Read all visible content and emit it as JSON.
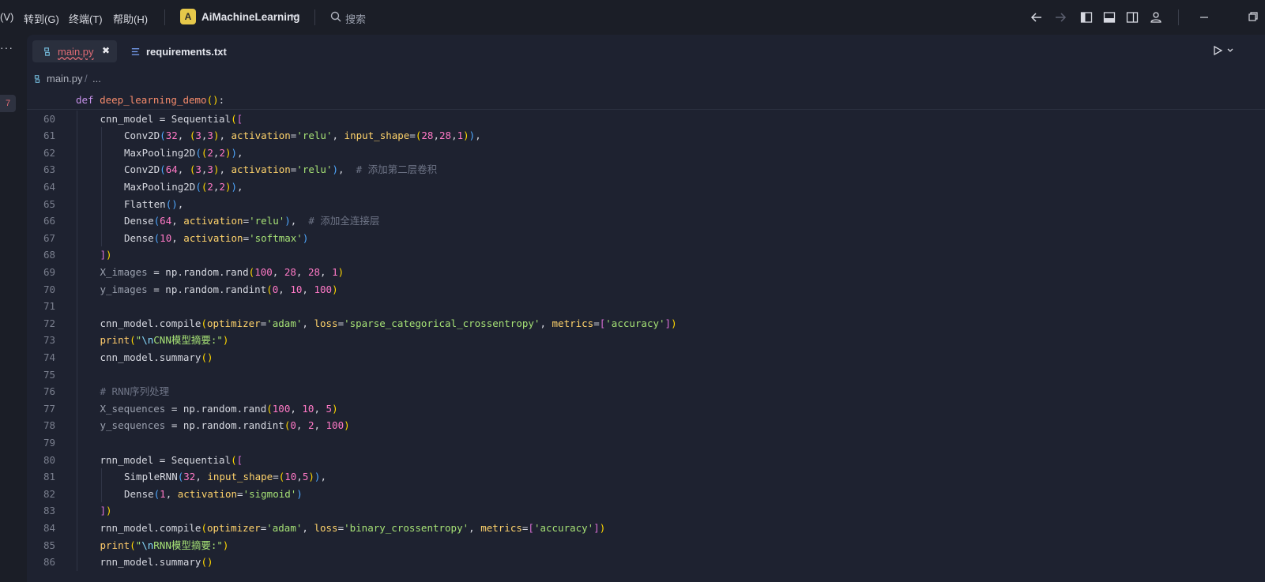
{
  "menubar": {
    "view_fragment": "(V)",
    "goto": "转到(G)",
    "terminal": "终端(T)",
    "help": "帮助(H)"
  },
  "project": {
    "badge": "A",
    "name": "AiMachineLearning"
  },
  "search": {
    "placeholder": "搜索"
  },
  "sidebar": {
    "more": "···",
    "badge": "7"
  },
  "tabs": [
    {
      "label": "main.py",
      "active": true,
      "close": "✖"
    },
    {
      "label": "requirements.txt",
      "active": false
    }
  ],
  "breadcrumb": {
    "file": "main.py",
    "sep": "/",
    "more": "..."
  },
  "colors": {
    "accent": "#e6c84a",
    "error_underline": "#e06c75",
    "editor_bg": "#1e2230"
  },
  "code": [
    {
      "n": "",
      "indent": 0,
      "t": [
        [
          "kw",
          "def"
        ],
        [
          "id",
          " "
        ],
        [
          "fn",
          "deep_learning_demo"
        ],
        [
          "b1",
          "()"
        ],
        [
          "op",
          ":"
        ]
      ]
    },
    {
      "n": "60",
      "indent": 1,
      "t": [
        [
          "id",
          "cnn_model = Sequential"
        ],
        [
          "b1",
          "("
        ],
        [
          "b2",
          "["
        ]
      ]
    },
    {
      "n": "61",
      "indent": 2,
      "t": [
        [
          "id",
          "Conv2D"
        ],
        [
          "b3",
          "("
        ],
        [
          "pnum",
          "32"
        ],
        [
          "op",
          ", "
        ],
        [
          "b1",
          "("
        ],
        [
          "pnum",
          "3"
        ],
        [
          "op",
          ","
        ],
        [
          "pnum",
          "3"
        ],
        [
          "b1",
          ")"
        ],
        [
          "op",
          ", "
        ],
        [
          "kwa",
          "activation"
        ],
        [
          "op",
          "="
        ],
        [
          "str",
          "'relu'"
        ],
        [
          "op",
          ", "
        ],
        [
          "kwa",
          "input_shape"
        ],
        [
          "op",
          "="
        ],
        [
          "b1",
          "("
        ],
        [
          "pnum",
          "28"
        ],
        [
          "op",
          ","
        ],
        [
          "pnum",
          "28"
        ],
        [
          "op",
          ","
        ],
        [
          "pnum",
          "1"
        ],
        [
          "b1",
          ")"
        ],
        [
          "b3",
          ")"
        ],
        [
          "op",
          ","
        ]
      ]
    },
    {
      "n": "62",
      "indent": 2,
      "t": [
        [
          "id",
          "MaxPooling2D"
        ],
        [
          "b3",
          "("
        ],
        [
          "b1",
          "("
        ],
        [
          "pnum",
          "2"
        ],
        [
          "op",
          ","
        ],
        [
          "pnum",
          "2"
        ],
        [
          "b1",
          ")"
        ],
        [
          "b3",
          ")"
        ],
        [
          "op",
          ","
        ]
      ]
    },
    {
      "n": "63",
      "indent": 2,
      "t": [
        [
          "id",
          "Conv2D"
        ],
        [
          "b3",
          "("
        ],
        [
          "pnum",
          "64"
        ],
        [
          "op",
          ", "
        ],
        [
          "b1",
          "("
        ],
        [
          "pnum",
          "3"
        ],
        [
          "op",
          ","
        ],
        [
          "pnum",
          "3"
        ],
        [
          "b1",
          ")"
        ],
        [
          "op",
          ", "
        ],
        [
          "kwa",
          "activation"
        ],
        [
          "op",
          "="
        ],
        [
          "str",
          "'relu'"
        ],
        [
          "b3",
          ")"
        ],
        [
          "op",
          ",  "
        ],
        [
          "cm",
          "# 添加第二层卷积"
        ]
      ]
    },
    {
      "n": "64",
      "indent": 2,
      "t": [
        [
          "id",
          "MaxPooling2D"
        ],
        [
          "b3",
          "("
        ],
        [
          "b1",
          "("
        ],
        [
          "pnum",
          "2"
        ],
        [
          "op",
          ","
        ],
        [
          "pnum",
          "2"
        ],
        [
          "b1",
          ")"
        ],
        [
          "b3",
          ")"
        ],
        [
          "op",
          ","
        ]
      ]
    },
    {
      "n": "65",
      "indent": 2,
      "t": [
        [
          "id",
          "Flatten"
        ],
        [
          "b3",
          "()"
        ],
        [
          "op",
          ","
        ]
      ]
    },
    {
      "n": "66",
      "indent": 2,
      "t": [
        [
          "id",
          "Dense"
        ],
        [
          "b3",
          "("
        ],
        [
          "pnum",
          "64"
        ],
        [
          "op",
          ", "
        ],
        [
          "kwa",
          "activation"
        ],
        [
          "op",
          "="
        ],
        [
          "str",
          "'relu'"
        ],
        [
          "b3",
          ")"
        ],
        [
          "op",
          ",  "
        ],
        [
          "cm",
          "# 添加全连接层"
        ]
      ]
    },
    {
      "n": "67",
      "indent": 2,
      "t": [
        [
          "id",
          "Dense"
        ],
        [
          "b3",
          "("
        ],
        [
          "pnum",
          "10"
        ],
        [
          "op",
          ", "
        ],
        [
          "kwa",
          "activation"
        ],
        [
          "op",
          "="
        ],
        [
          "str",
          "'softmax'"
        ],
        [
          "b3",
          ")"
        ]
      ]
    },
    {
      "n": "68",
      "indent": 1,
      "t": [
        [
          "b2",
          "]"
        ],
        [
          "b1",
          ")"
        ]
      ]
    },
    {
      "n": "69",
      "indent": 1,
      "t": [
        [
          "var",
          "X_images"
        ],
        [
          "op",
          " = np.random.rand"
        ],
        [
          "b1",
          "("
        ],
        [
          "pnum",
          "100"
        ],
        [
          "op",
          ", "
        ],
        [
          "pnum",
          "28"
        ],
        [
          "op",
          ", "
        ],
        [
          "pnum",
          "28"
        ],
        [
          "op",
          ", "
        ],
        [
          "pnum",
          "1"
        ],
        [
          "b1",
          ")"
        ]
      ]
    },
    {
      "n": "70",
      "indent": 1,
      "t": [
        [
          "var",
          "y_images"
        ],
        [
          "op",
          " = np.random.randint"
        ],
        [
          "b1",
          "("
        ],
        [
          "pnum",
          "0"
        ],
        [
          "op",
          ", "
        ],
        [
          "pnum",
          "10"
        ],
        [
          "op",
          ", "
        ],
        [
          "pnum",
          "100"
        ],
        [
          "b1",
          ")"
        ]
      ]
    },
    {
      "n": "71",
      "indent": 1,
      "t": []
    },
    {
      "n": "72",
      "indent": 1,
      "t": [
        [
          "id",
          "cnn_model.compile"
        ],
        [
          "b1",
          "("
        ],
        [
          "kwa",
          "optimizer"
        ],
        [
          "op",
          "="
        ],
        [
          "str",
          "'adam'"
        ],
        [
          "op",
          ", "
        ],
        [
          "kwa",
          "loss"
        ],
        [
          "op",
          "="
        ],
        [
          "str",
          "'sparse_categorical_crossentropy'"
        ],
        [
          "op",
          ", "
        ],
        [
          "kwa",
          "metrics"
        ],
        [
          "op",
          "="
        ],
        [
          "b2",
          "["
        ],
        [
          "str",
          "'accuracy'"
        ],
        [
          "b2",
          "]"
        ],
        [
          "b1",
          ")"
        ]
      ]
    },
    {
      "n": "73",
      "indent": 1,
      "t": [
        [
          "bi",
          "print"
        ],
        [
          "b1",
          "("
        ],
        [
          "str",
          "\""
        ],
        [
          "esc",
          "\\n"
        ],
        [
          "str",
          "CNN模型摘要:\""
        ],
        [
          "b1",
          ")"
        ]
      ]
    },
    {
      "n": "74",
      "indent": 1,
      "t": [
        [
          "id",
          "cnn_model.summary"
        ],
        [
          "b1",
          "()"
        ]
      ]
    },
    {
      "n": "75",
      "indent": 1,
      "t": []
    },
    {
      "n": "76",
      "indent": 1,
      "t": [
        [
          "cm",
          "# RNN序列处理"
        ]
      ]
    },
    {
      "n": "77",
      "indent": 1,
      "t": [
        [
          "var",
          "X_sequences"
        ],
        [
          "op",
          " = np.random.rand"
        ],
        [
          "b1",
          "("
        ],
        [
          "pnum",
          "100"
        ],
        [
          "op",
          ", "
        ],
        [
          "pnum",
          "10"
        ],
        [
          "op",
          ", "
        ],
        [
          "pnum",
          "5"
        ],
        [
          "b1",
          ")"
        ]
      ]
    },
    {
      "n": "78",
      "indent": 1,
      "t": [
        [
          "var",
          "y_sequences"
        ],
        [
          "op",
          " = np.random.randint"
        ],
        [
          "b1",
          "("
        ],
        [
          "pnum",
          "0"
        ],
        [
          "op",
          ", "
        ],
        [
          "pnum",
          "2"
        ],
        [
          "op",
          ", "
        ],
        [
          "pnum",
          "100"
        ],
        [
          "b1",
          ")"
        ]
      ]
    },
    {
      "n": "79",
      "indent": 1,
      "t": []
    },
    {
      "n": "80",
      "indent": 1,
      "t": [
        [
          "id",
          "rnn_model = Sequential"
        ],
        [
          "b1",
          "("
        ],
        [
          "b2",
          "["
        ]
      ]
    },
    {
      "n": "81",
      "indent": 2,
      "t": [
        [
          "id",
          "SimpleRNN"
        ],
        [
          "b3",
          "("
        ],
        [
          "pnum",
          "32"
        ],
        [
          "op",
          ", "
        ],
        [
          "kwa",
          "input_shape"
        ],
        [
          "op",
          "="
        ],
        [
          "b1",
          "("
        ],
        [
          "pnum",
          "10"
        ],
        [
          "op",
          ","
        ],
        [
          "pnum",
          "5"
        ],
        [
          "b1",
          ")"
        ],
        [
          "b3",
          ")"
        ],
        [
          "op",
          ","
        ]
      ]
    },
    {
      "n": "82",
      "indent": 2,
      "t": [
        [
          "id",
          "Dense"
        ],
        [
          "b3",
          "("
        ],
        [
          "pnum",
          "1"
        ],
        [
          "op",
          ", "
        ],
        [
          "kwa",
          "activation"
        ],
        [
          "op",
          "="
        ],
        [
          "str",
          "'sigmoid'"
        ],
        [
          "b3",
          ")"
        ]
      ]
    },
    {
      "n": "83",
      "indent": 1,
      "t": [
        [
          "b2",
          "]"
        ],
        [
          "b1",
          ")"
        ]
      ]
    },
    {
      "n": "84",
      "indent": 1,
      "t": [
        [
          "id",
          "rnn_model.compile"
        ],
        [
          "b1",
          "("
        ],
        [
          "kwa",
          "optimizer"
        ],
        [
          "op",
          "="
        ],
        [
          "str",
          "'adam'"
        ],
        [
          "op",
          ", "
        ],
        [
          "kwa",
          "loss"
        ],
        [
          "op",
          "="
        ],
        [
          "str",
          "'binary_crossentropy'"
        ],
        [
          "op",
          ", "
        ],
        [
          "kwa",
          "metrics"
        ],
        [
          "op",
          "="
        ],
        [
          "b2",
          "["
        ],
        [
          "str",
          "'accuracy'"
        ],
        [
          "b2",
          "]"
        ],
        [
          "b1",
          ")"
        ]
      ]
    },
    {
      "n": "85",
      "indent": 1,
      "t": [
        [
          "bi",
          "print"
        ],
        [
          "b1",
          "("
        ],
        [
          "str",
          "\""
        ],
        [
          "esc",
          "\\n"
        ],
        [
          "str",
          "RNN模型摘要:\""
        ],
        [
          "b1",
          ")"
        ]
      ]
    },
    {
      "n": "86",
      "indent": 1,
      "t": [
        [
          "id",
          "rnn_model.summary"
        ],
        [
          "b1",
          "()"
        ]
      ]
    }
  ]
}
